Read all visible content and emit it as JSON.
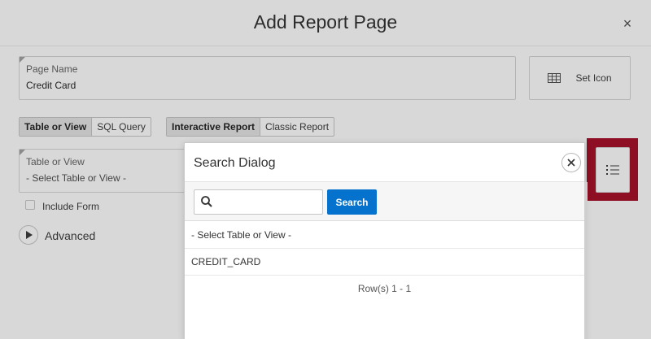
{
  "dialog": {
    "title": "Add Report Page",
    "close_label": "×"
  },
  "page_name": {
    "label": "Page Name",
    "value": "Credit Card"
  },
  "set_icon": {
    "label": "Set Icon",
    "icon": "table-icon"
  },
  "source_type": {
    "options": [
      "Table or View",
      "SQL Query"
    ],
    "selected": "Table or View"
  },
  "report_type": {
    "options": [
      "Interactive Report",
      "Classic Report"
    ],
    "selected": "Interactive Report"
  },
  "table_or_view": {
    "label": "Table or View",
    "value": "- Select Table or View -",
    "list_button_icon": "list-icon"
  },
  "include_form": {
    "label": "Include Form",
    "checked": false
  },
  "advanced": {
    "label": "Advanced",
    "icon": "play-icon"
  },
  "search_dialog": {
    "title": "Search Dialog",
    "search_placeholder": "",
    "search_button": "Search",
    "rows": [
      "- Select Table or View -",
      "CREDIT_CARD"
    ],
    "row_count": "Row(s) 1 - 1"
  },
  "colors": {
    "highlight": "#8e0f24",
    "search_button": "#0572ce",
    "background": "#d8d8d8"
  }
}
